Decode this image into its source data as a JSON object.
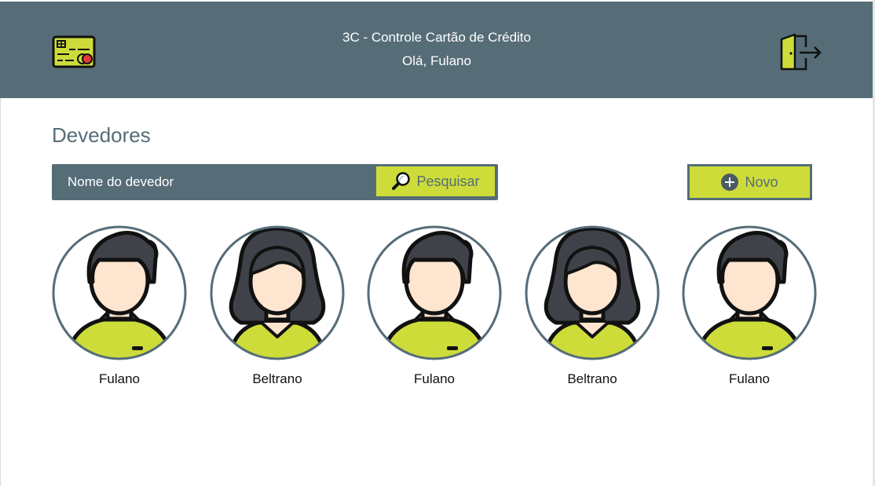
{
  "header": {
    "app_title": "3C - Controle Cartão de Crédito",
    "greeting": "Olá, Fulano",
    "logo_icon": "credit-card-icon",
    "logout_icon": "logout-door-icon"
  },
  "page": {
    "title": "Devedores"
  },
  "search": {
    "placeholder": "Nome do devedor",
    "button_label": "Pesquisar",
    "button_icon": "magnifier-icon"
  },
  "new_button": {
    "label": "Novo",
    "icon": "plus-circle-icon"
  },
  "debtors": [
    {
      "name": "Fulano",
      "avatar": "male-avatar-icon"
    },
    {
      "name": "Beltrano",
      "avatar": "female-avatar-icon"
    },
    {
      "name": "Fulano",
      "avatar": "male-avatar-icon"
    },
    {
      "name": "Beltrano",
      "avatar": "female-avatar-icon"
    },
    {
      "name": "Fulano",
      "avatar": "male-avatar-icon"
    }
  ],
  "colors": {
    "primary": "#566d78",
    "accent": "#cddc39",
    "skin": "#fde5cf",
    "hair": "#3f4249"
  }
}
